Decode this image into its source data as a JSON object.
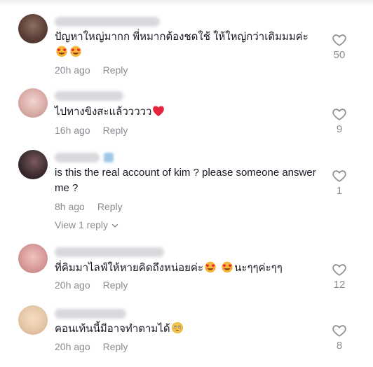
{
  "comments": [
    {
      "text": "ปัญหาใหญ่มากก พี่หมากต้องชดใช้ ให้ใหญ่กว่าเดิมมมค่ะ",
      "time": "20h ago",
      "reply_label": "Reply",
      "likes": "50",
      "avatar_color": "#6b4f4a"
    },
    {
      "text": "ไปทางขิงสะแล้ววววว",
      "time": "16h ago",
      "reply_label": "Reply",
      "likes": "9",
      "avatar_color": "#e8c4c4"
    },
    {
      "text": "is this the real account of kim ? please someone answer me ?",
      "time": "8h ago",
      "reply_label": "Reply",
      "likes": "1",
      "view_replies": "View 1 reply",
      "avatar_color": "#3a2a2e"
    },
    {
      "text": "ที่คิมมาไลฟ์ให้หายคิดถึงหน่อยค่ะ",
      "text_suffix": "นะๆๆค่ะๆๆ",
      "time": "20h ago",
      "reply_label": "Reply",
      "likes": "12",
      "avatar_color": "#d79a9a"
    },
    {
      "text": "คอนเท้นนี้มีอาจทำตามได้",
      "time": "20h ago",
      "reply_label": "Reply",
      "likes": "8",
      "avatar_color": "#e6c8a8"
    }
  ],
  "colors": {
    "text": "#161823",
    "muted": "#8a8b91",
    "heart_red": "#e3263e"
  }
}
